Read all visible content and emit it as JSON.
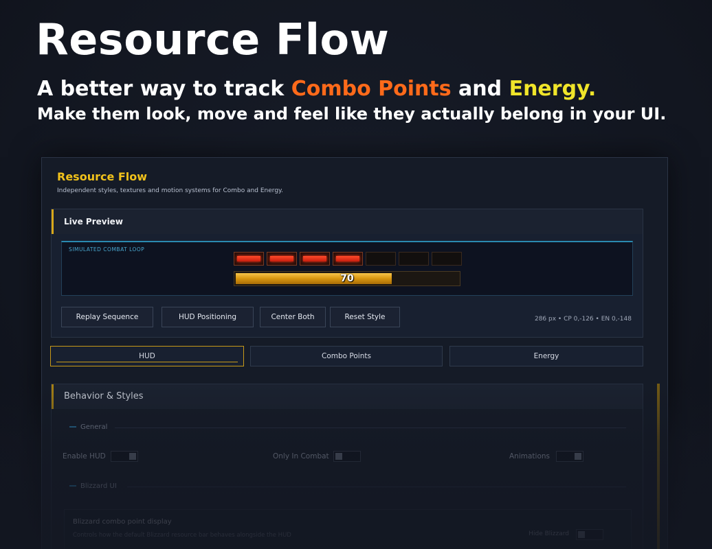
{
  "hero": {
    "title": "Resource Flow",
    "line1_prefix": "A better way to track ",
    "line1_combo": "Combo Points",
    "line1_mid": " and ",
    "line1_energy": "Energy.",
    "line2": "Make them look, move and feel like they actually belong in your UI."
  },
  "window": {
    "title": "Resource Flow",
    "subtitle": "Independent styles, textures and motion systems for Combo and Energy."
  },
  "preview": {
    "header": "Live Preview",
    "sim_label": "SIMULATED COMBAT LOOP",
    "combo_points_filled": 4,
    "combo_points_max": 7,
    "energy_value": "70",
    "energy_fraction": 0.7,
    "buttons": {
      "replay": "Replay Sequence",
      "hud_positioning": "HUD Positioning",
      "center_both": "Center Both",
      "reset_style": "Reset Style"
    },
    "coords": "286 px  •  CP 0,-126  •  EN 0,-148"
  },
  "tabs": [
    {
      "label": "HUD",
      "active": true
    },
    {
      "label": "Combo Points",
      "active": false
    },
    {
      "label": "Energy",
      "active": false
    }
  ],
  "behavior": {
    "header": "Behavior & Styles",
    "general_label": "General",
    "options": {
      "enable_hud": "Enable HUD",
      "only_in_combat": "Only In Combat",
      "animations": "Animations"
    },
    "blizzard_label": "Blizzard UI",
    "sub_title": "Blizzard combo point display",
    "sub_desc": "Controls how the default Blizzard resource bar behaves alongside the HUD",
    "sub_right": "Hide Blizzard"
  },
  "colors": {
    "accent_gold": "#f1c21b",
    "combo_orange": "#ff6a1a",
    "energy_yellow": "#f0e52a",
    "combo_red": "#ff4a2a"
  }
}
